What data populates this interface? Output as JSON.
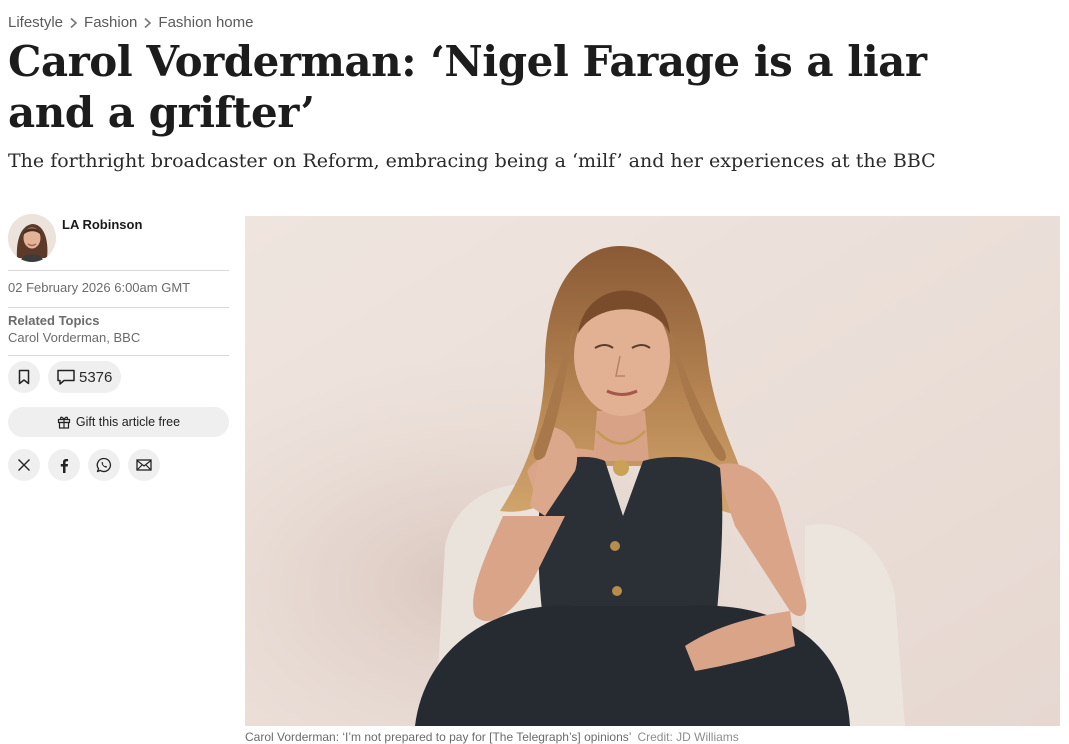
{
  "breadcrumb": [
    "Lifestyle",
    "Fashion",
    "Fashion home"
  ],
  "article": {
    "headline": "Carol Vorderman: ‘Nigel Farage is a liar and a grifter’",
    "standfirst": "The forthright broadcaster on Reform, embracing being a ‘milf’ and her experiences at the BBC"
  },
  "author": {
    "name": "LA Robinson",
    "avatar_icon": "author-avatar"
  },
  "meta": {
    "date": "02 February 2026 6:00am GMT",
    "related_label": "Related Topics",
    "topics": [
      "Carol Vorderman",
      "BBC"
    ],
    "topics_separator": ", "
  },
  "actions": {
    "bookmark_icon": "bookmark-icon",
    "comment_icon": "comment-icon",
    "comments_count": "5376",
    "gift_icon": "gift-icon",
    "gift_label": "Gift this article free",
    "share_icons": [
      "x-icon",
      "facebook-icon",
      "whatsapp-icon",
      "email-icon"
    ]
  },
  "image": {
    "caption": "Carol Vorderman: ‘I’m not prepared to pay for [The Telegraph’s] opinions’",
    "credit": "Credit: JD Williams"
  },
  "colors": {
    "text": "#1a1a1a",
    "muted": "#6b6b6b",
    "button_bg": "#efefef",
    "divider": "#d9d9d9",
    "photo_bg": "#ece2dc"
  }
}
